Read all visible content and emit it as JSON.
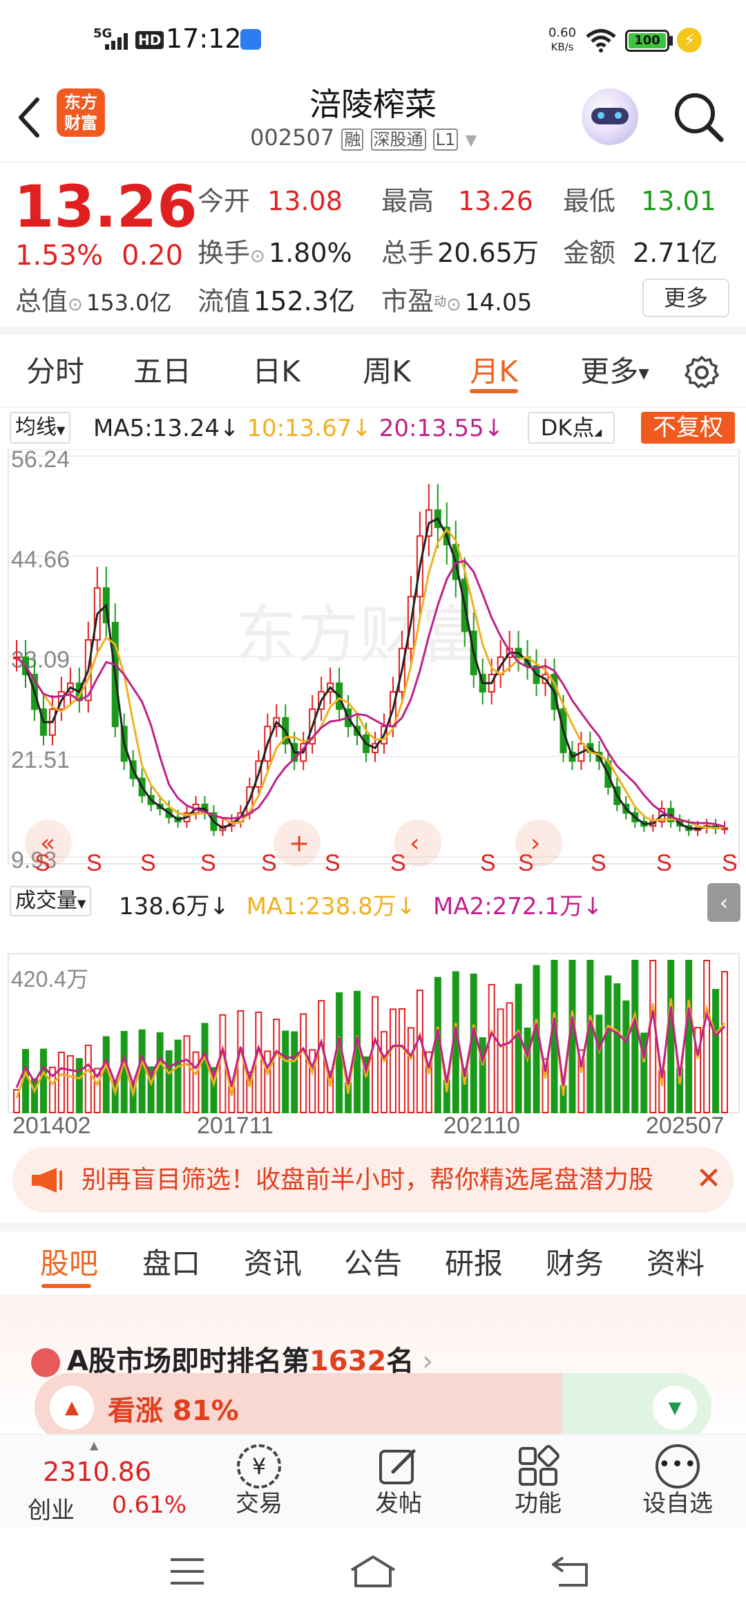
{
  "status": {
    "network": "5G",
    "hd": "HD",
    "time": "17:12",
    "speed_top": "0.60",
    "speed_bottom": "KB/s",
    "battery": "100"
  },
  "header": {
    "back_icon": "chevron-left-icon",
    "logo_line1": "东方",
    "logo_line2": "财富",
    "title": "涪陵榨菜",
    "code": "002507",
    "tag1": "融",
    "tag2": "深股通",
    "tag3": "L1"
  },
  "quote": {
    "price": "13.26",
    "change_pct": "1.53%",
    "change": "0.20",
    "open_label": "今开",
    "open": "13.08",
    "high_label": "最高",
    "high": "13.26",
    "low_label": "最低",
    "low": "13.01",
    "turnover_label": "换手",
    "turnover": "1.80%",
    "volume_label": "总手",
    "volume": "20.65万",
    "amount_label": "金额",
    "amount": "2.71亿",
    "mcap_label": "总值",
    "mcap": "153.0亿",
    "float_label": "流值",
    "float": "152.3亿",
    "pe_label": "市盈",
    "pe_sup": "动",
    "pe": "14.05",
    "more_label": "更多"
  },
  "tabs": {
    "items": [
      "分时",
      "五日",
      "日K",
      "周K",
      "月K",
      "更多"
    ],
    "active": "月K",
    "settings_icon": "gear-icon"
  },
  "chart_data": {
    "type": "candlestick",
    "ma_toggle": "均线",
    "ma5": "MA5:13.24",
    "ma10": "10:13.67",
    "ma20": "20:13.55",
    "dk": "DK点",
    "fq": "不复权",
    "y_ticks": [
      "56.24",
      "44.66",
      "33.09",
      "21.51",
      "9.93"
    ],
    "vol_toggle": "成交量",
    "vol_value": "138.6万",
    "vol_ma1": "MA1:238.8万",
    "vol_ma2": "MA2:272.1万",
    "vol_max": "420.4万",
    "x_ticks": [
      "201402",
      "201711",
      "202110",
      "202507"
    ],
    "s_marker": "S",
    "watermark": "东方财富",
    "colors": {
      "up": "#e02020",
      "down": "#1a9a1a",
      "ma5": "#222222",
      "ma10": "#f0b020",
      "ma20": "#c0208a"
    }
  },
  "banner": {
    "text": "别再盲目筛选！收盘前半小时，帮你精选尾盘潜力股",
    "close_icon": "close-icon",
    "speaker_icon": "megaphone-icon"
  },
  "bottom_tabs": {
    "items": [
      "股吧",
      "盘口",
      "资讯",
      "公告",
      "研报",
      "财务",
      "资料"
    ],
    "active": "股吧"
  },
  "ranking": {
    "prefix": "A股市场即时排名第",
    "rank": "1632",
    "suffix": "名",
    "bull_label": "看涨 81%"
  },
  "footer": {
    "index_value": "2310.86",
    "index_name": "创业",
    "index_change": "0.61%",
    "trade": "交易",
    "post": "发帖",
    "func": "功能",
    "watch": "设自选"
  }
}
